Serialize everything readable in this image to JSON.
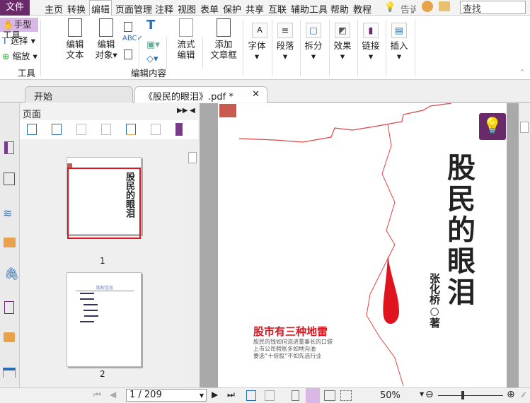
{
  "menu": {
    "file": "文件",
    "items": [
      "主页",
      "转换",
      "编辑",
      "页面管理",
      "注释",
      "视图",
      "表单",
      "保护",
      "共享",
      "互联",
      "辅助工具",
      "帮助",
      "教程"
    ],
    "tell": "告诉",
    "search_placeholder": "查找"
  },
  "ribbon": {
    "hand": "手型工具",
    "select": "选择",
    "zoom": "缩放",
    "tools_group": "工具",
    "edit_text": [
      "编辑",
      "文本"
    ],
    "edit_obj": [
      "编辑",
      "对象"
    ],
    "flow": [
      "流式",
      "编辑"
    ],
    "add_box": [
      "添加",
      "文章框"
    ],
    "edit_group": "编辑内容",
    "font": "字体",
    "para": "段落",
    "split": "拆分",
    "effect": "效果",
    "link": "链接",
    "insert": "插入"
  },
  "tabs": [
    {
      "label": "开始"
    },
    {
      "label": "《股民的眼泪》.pdf *"
    }
  ],
  "panel": {
    "title": "页面",
    "pages": [
      "1",
      "2"
    ]
  },
  "document": {
    "title": "股民的眼泪",
    "author": "张化桥",
    "author_suffix": "著",
    "headline": "股市有三种地雷",
    "lines": [
      "股民的钱如何流进董事长的口袋",
      "上市公司假账多如地沟油",
      "要选“十倍股”不如先选行业"
    ],
    "thumb2_heading": "版权信息"
  },
  "status": {
    "page": "1 / 209",
    "zoom": "50%",
    "zoom_level": 0.3
  },
  "colors": {
    "accent": "#6a2a6a",
    "highlight": "#d9b8e6",
    "red": "#d8141e"
  }
}
